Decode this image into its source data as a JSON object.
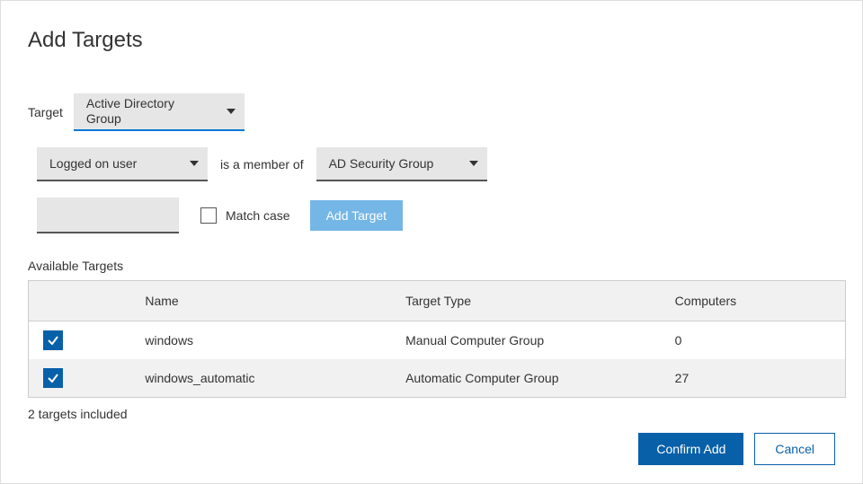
{
  "title": "Add Targets",
  "target_label": "Target",
  "target_dropdown": "Active Directory Group",
  "logged_dropdown": "Logged on user",
  "member_text": "is a member of",
  "adsec_dropdown": "AD Security Group",
  "match_case_label": "Match case",
  "add_target_btn": "Add Target",
  "available_label": "Available Targets",
  "columns": {
    "name": "Name",
    "type": "Target Type",
    "computers": "Computers"
  },
  "rows": [
    {
      "checked": true,
      "name": "windows",
      "type": "Manual Computer Group",
      "computers": "0"
    },
    {
      "checked": true,
      "name": "windows_automatic",
      "type": "Automatic Computer Group",
      "computers": "27"
    }
  ],
  "summary": "2 targets included",
  "confirm_btn": "Confirm Add",
  "cancel_btn": "Cancel"
}
